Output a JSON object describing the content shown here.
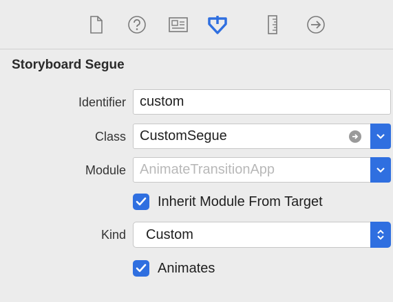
{
  "toolbar": {
    "icons": [
      "file-icon",
      "help-icon",
      "identity-icon",
      "attributes-icon",
      "ruler-icon",
      "connections-icon"
    ]
  },
  "section": {
    "title": "Storyboard Segue"
  },
  "fields": {
    "identifier": {
      "label": "Identifier",
      "value": "custom"
    },
    "class": {
      "label": "Class",
      "value": "CustomSegue"
    },
    "module": {
      "label": "Module",
      "placeholder": "AnimateTransitionApp"
    },
    "inherit": {
      "label": "Inherit Module From Target",
      "checked": true
    },
    "kind": {
      "label": "Kind",
      "value": "Custom"
    },
    "animates": {
      "label": "Animates",
      "checked": true
    }
  },
  "colors": {
    "accent": "#2f6fe0",
    "background": "#ececec"
  }
}
